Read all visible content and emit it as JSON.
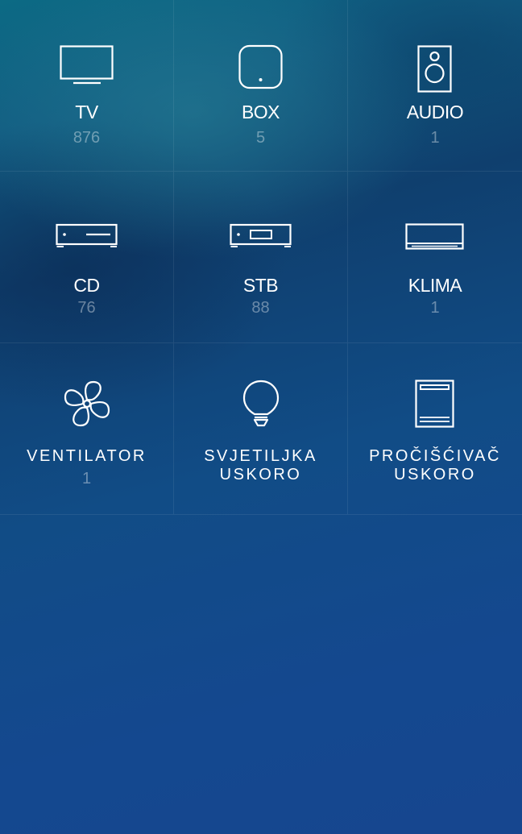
{
  "devices": [
    {
      "label": "TV",
      "count": "876",
      "icon": "tv-icon"
    },
    {
      "label": "BOX",
      "count": "5",
      "icon": "box-icon"
    },
    {
      "label": "AUDIO",
      "count": "1",
      "icon": "speaker-icon"
    },
    {
      "label": "CD",
      "count": "76",
      "icon": "cd-player-icon"
    },
    {
      "label": "STB",
      "count": "88",
      "icon": "set-top-box-icon"
    },
    {
      "label": "KLIMA",
      "count": "1",
      "icon": "air-conditioner-icon"
    },
    {
      "label": "VENTILATOR",
      "count": "1",
      "icon": "fan-icon"
    },
    {
      "label": "SVJETILJKA",
      "sublabel": "USKORO",
      "icon": "light-bulb-icon"
    },
    {
      "label": "PROČIŠĆIVAČ",
      "sublabel": "USKORO",
      "icon": "air-purifier-icon"
    }
  ],
  "colors": {
    "background_top": "#0c6a84",
    "background_bottom": "#16468f",
    "label": "#ffffff",
    "count": "rgba(255,255,255,0.38)",
    "divider": "rgba(255,255,255,0.08)"
  }
}
